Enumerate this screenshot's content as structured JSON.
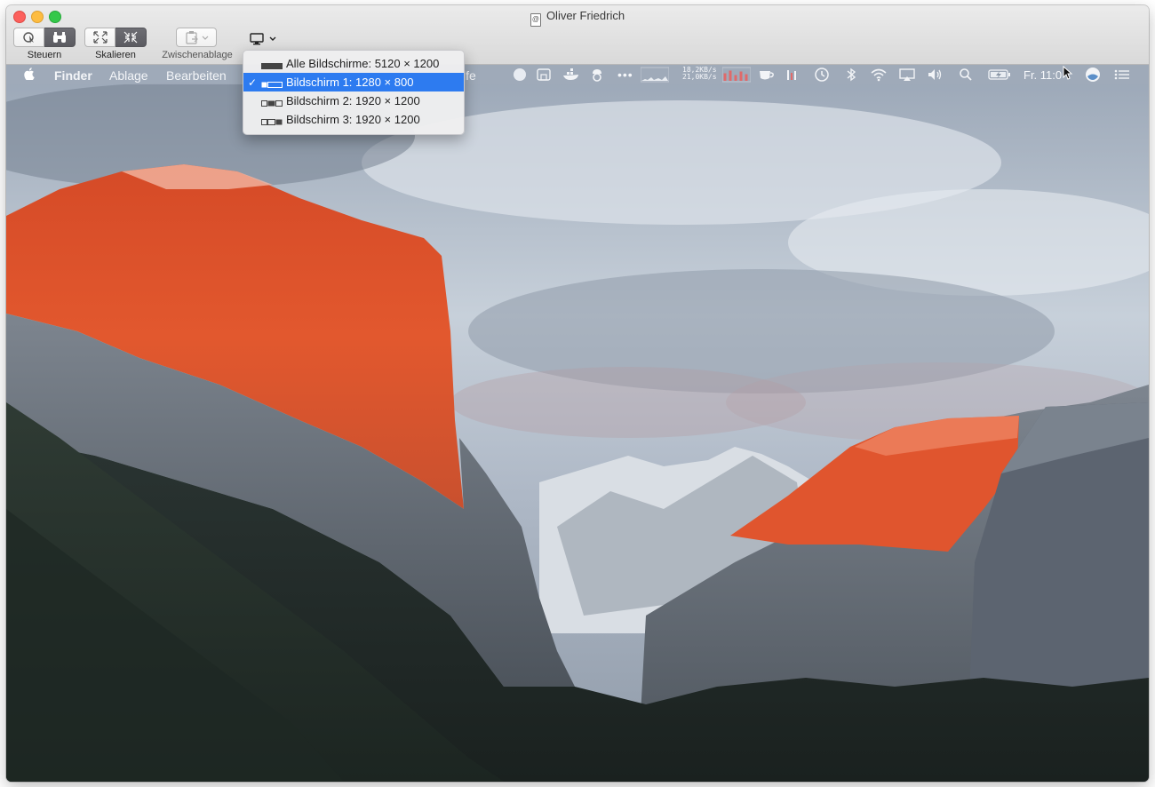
{
  "window": {
    "title": "Oliver Friedrich"
  },
  "toolbar": {
    "control_label": "Steuern",
    "scale_label": "Skalieren",
    "clipboard_label": "Zwischenablage"
  },
  "display_menu": {
    "items": [
      {
        "label": "Alle Bildschirme: 5120 × 1200",
        "checked": false
      },
      {
        "label": "Bildschirm 1: 1280 × 800",
        "checked": true
      },
      {
        "label": "Bildschirm 2: 1920 × 1200",
        "checked": false
      },
      {
        "label": "Bildschirm 3: 1920 × 1200",
        "checked": false
      }
    ],
    "check_mark": "✓"
  },
  "remote_menubar": {
    "apple": "",
    "items": [
      "Finder",
      "Ablage",
      "Bearbeiten"
    ],
    "partial_item": "lfe",
    "network_up": "18,2KB/s",
    "network_down": "21,0KB/s",
    "clock": "Fr. 11:0"
  },
  "colors": {
    "selection": "#2d7bf0",
    "close": "#fc605c",
    "minimize": "#fdbc40",
    "zoom": "#34c84a",
    "alpenglow": "#e8532a"
  }
}
